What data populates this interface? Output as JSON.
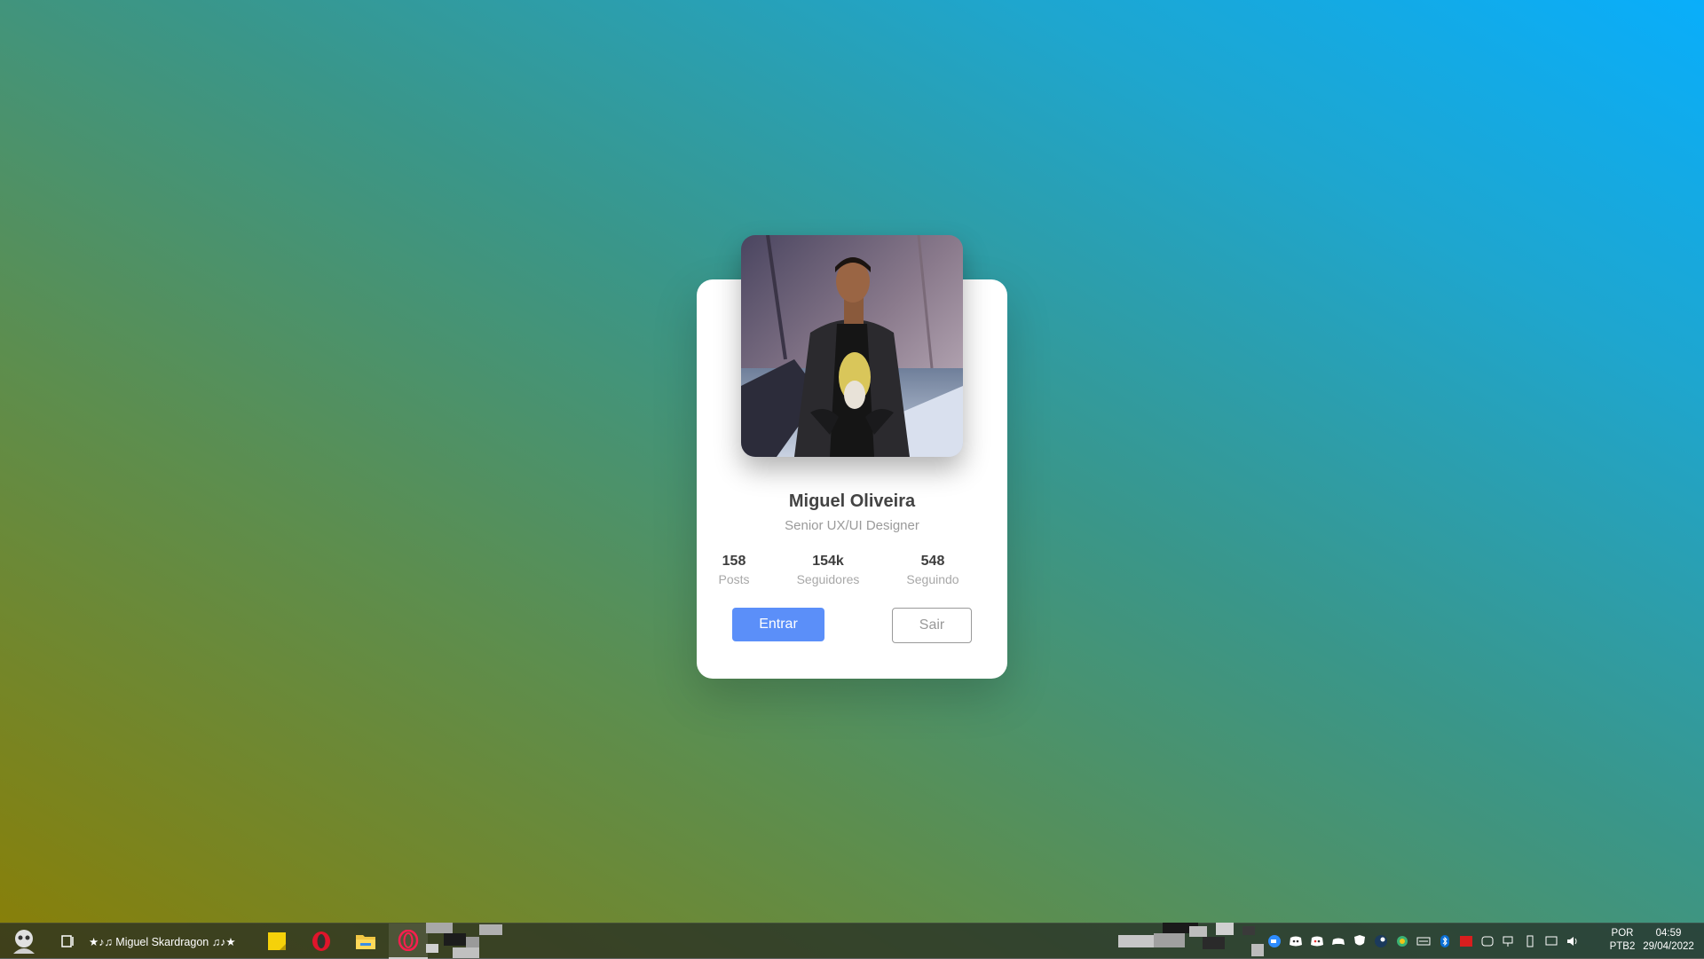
{
  "profile": {
    "name": "Miguel Oliveira",
    "role": "Senior UX/UI Designer",
    "stats": [
      {
        "value": "158",
        "label": "Posts"
      },
      {
        "value": "154k",
        "label": "Seguidores"
      },
      {
        "value": "548",
        "label": "Seguindo"
      }
    ],
    "buttons": {
      "enter_label": "Entrar",
      "exit_label": "Sair"
    }
  },
  "taskbar": {
    "user_label": "★♪♫ Miguel Skardragon ♫♪★",
    "apps": [
      "sticky-notes-icon",
      "opera-icon",
      "file-explorer-icon",
      "opera-gx-icon"
    ],
    "tray_icons": [
      "zoom-icon",
      "discord-icon",
      "discord-icon",
      "gamepad-icon",
      "shield-icon",
      "steam-icon",
      "colorful-icon",
      "keyboard-icon",
      "bluetooth-icon",
      "adobe-icon",
      "network-adapter-icon",
      "network-icon",
      "usb-icon",
      "display-icon",
      "volume-icon"
    ],
    "language": "POR",
    "keyboard": "PTB2",
    "time": "04:59",
    "date": "29/04/2022"
  },
  "colors": {
    "accent": "#5b8ff9",
    "gradient_bottom_left": "#8a7f06",
    "gradient_top_right": "#09aefb"
  }
}
